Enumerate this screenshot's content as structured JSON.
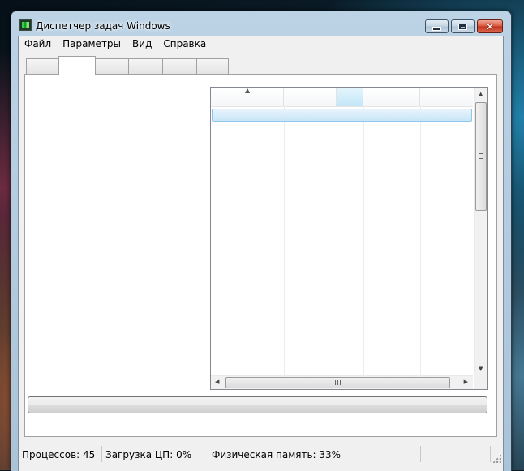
{
  "window": {
    "title": "Диспетчер задач Windows"
  },
  "menu": {
    "items": [
      "Файл",
      "Параметры",
      "Вид",
      "Справка"
    ]
  },
  "tabs": {
    "count": 6,
    "active_index": 1
  },
  "status": {
    "processes": "Процессов: 45",
    "cpu": "Загрузка ЦП: 0%",
    "memory": "Физическая память: 33%"
  },
  "colors": {
    "accent": "#c2e6f7",
    "close": "#c2321a"
  }
}
